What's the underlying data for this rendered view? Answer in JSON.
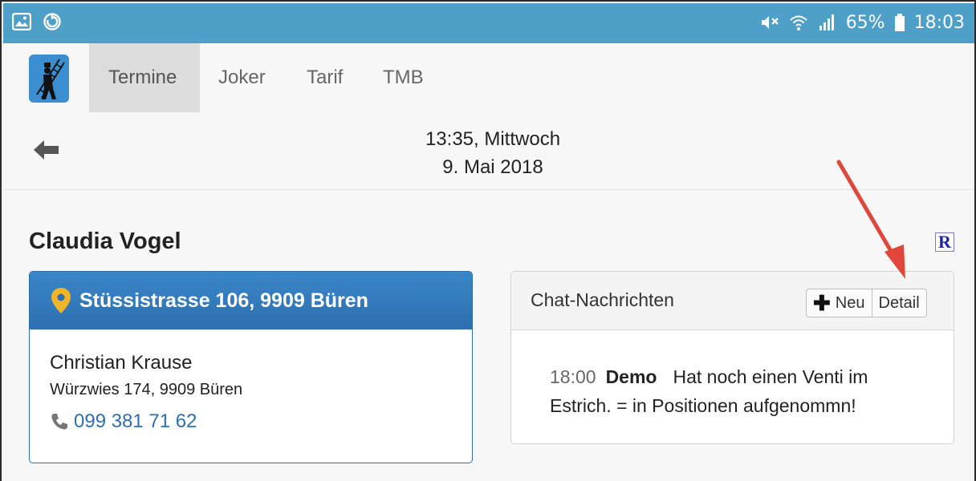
{
  "statusbar": {
    "left_icons": [
      "image-icon",
      "sync-icon"
    ],
    "right_icons": [
      "mute-icon",
      "wifi-icon",
      "signal-icon",
      "battery-icon"
    ],
    "battery_text": "65%",
    "time": "18:03"
  },
  "nav": {
    "logo": "chimney-sweep-logo",
    "tabs": [
      {
        "label": "Termine",
        "active": true
      },
      {
        "label": "Joker",
        "active": false
      },
      {
        "label": "Tarif",
        "active": false
      },
      {
        "label": "TMB",
        "active": false
      }
    ]
  },
  "header": {
    "time_day": "13:35, Mittwoch",
    "date": "9. Mai 2018"
  },
  "customer": {
    "name": "Claudia Vogel",
    "badge": "R"
  },
  "address_card": {
    "address": "Stüssistrasse 106, 9909 Büren",
    "contact_name": "Christian Krause",
    "contact_address": "Würzwies 174, 9909 Büren",
    "phone": "099 381 71 62"
  },
  "chat": {
    "title": "Chat-Nachrichten",
    "new_button": "Neu",
    "detail_button": "Detail",
    "messages": [
      {
        "time": "18:00",
        "user": "Demo",
        "text": "Hat noch einen Venti im Estrich. = in Positionen aufgenommn!"
      }
    ]
  },
  "colors": {
    "statusbar": "#4fa0c9",
    "address_header": "#2d6fb0",
    "annotation_arrow": "#e0463a"
  }
}
